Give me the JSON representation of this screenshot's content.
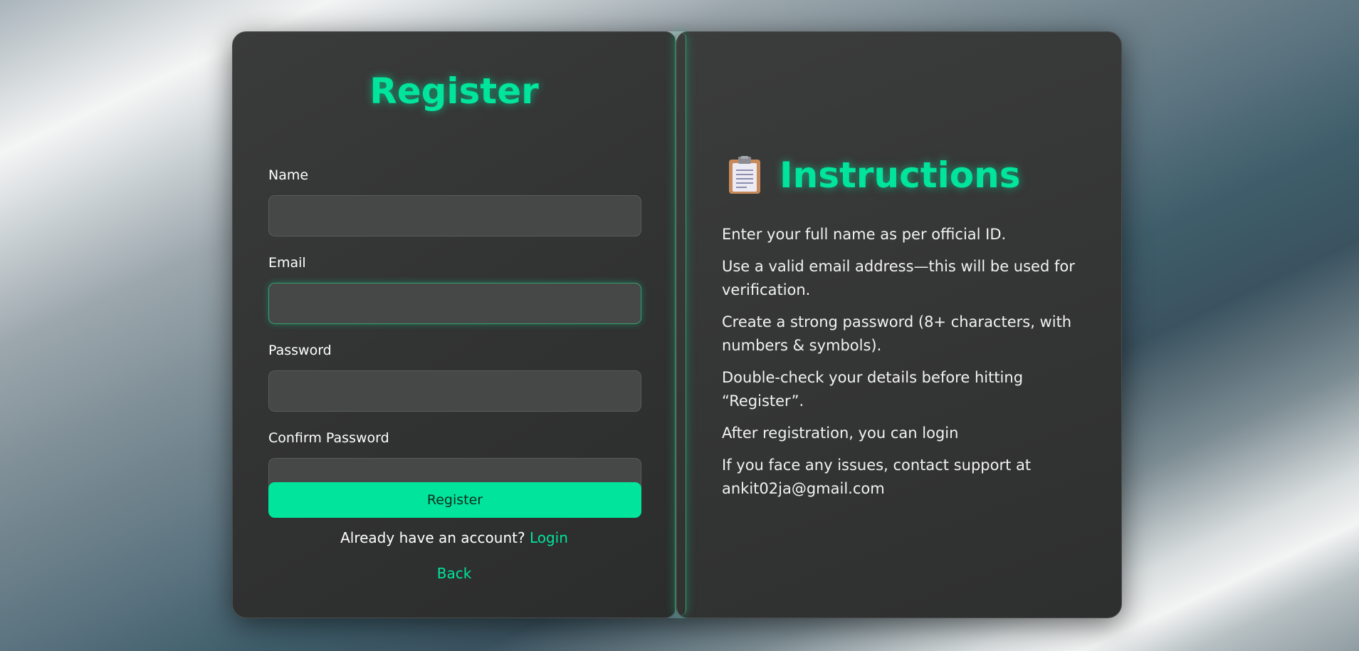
{
  "register": {
    "title": "Register",
    "fields": [
      {
        "label": "Name",
        "value": "",
        "placeholder": ""
      },
      {
        "label": "Email",
        "value": "",
        "placeholder": ""
      },
      {
        "label": "Password",
        "value": "",
        "placeholder": ""
      },
      {
        "label": "Confirm Password",
        "value": "",
        "placeholder": ""
      }
    ],
    "submit_label": "Register",
    "account_prompt": "Already have an account?",
    "login_link": "Login",
    "back_link": "Back"
  },
  "instructions": {
    "icon": "clipboard-icon",
    "title": "Instructions",
    "items": [
      "Enter your full name as per official ID.",
      "Use a valid email address—this will be used for verification.",
      "Create a strong password (8+ characters, with numbers & symbols).",
      "Double-check your details before hitting “Register”.",
      "After registration, you can login",
      "If you face any issues, contact support at ankit02ja@gmail.com"
    ]
  },
  "colors": {
    "accent": "#00e59b",
    "panel": "#333434",
    "input": "#464747"
  }
}
